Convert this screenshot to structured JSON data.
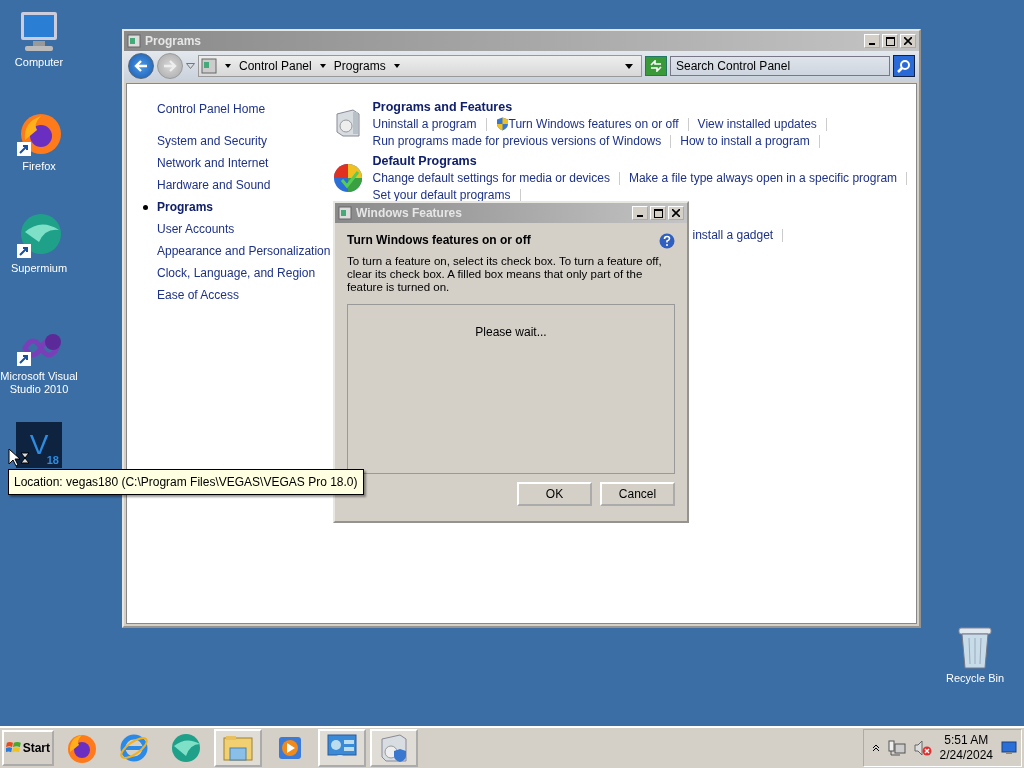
{
  "desktop_icons": [
    {
      "kind": "computer",
      "label": "Computer"
    },
    {
      "kind": "firefox",
      "label": "Firefox"
    },
    {
      "kind": "supermium",
      "label": "Supermium"
    },
    {
      "kind": "visualstudio",
      "label": "Microsoft Visual Studio 2010"
    },
    {
      "kind": "vegas",
      "logo": "V",
      "version": "18"
    },
    {
      "kind": "recyclebin",
      "label": "Recycle Bin"
    }
  ],
  "window": {
    "title": "Programs",
    "address": {
      "crumbs": [
        "Control Panel",
        "Programs"
      ]
    },
    "search": {
      "placeholder": "Search Control Panel"
    },
    "nav": {
      "items": [
        {
          "label": "Control Panel Home",
          "selected": false
        },
        {
          "label": "System and Security",
          "selected": false
        },
        {
          "label": "Network and Internet",
          "selected": false
        },
        {
          "label": "Hardware and Sound",
          "selected": false
        },
        {
          "label": "Programs",
          "selected": true
        },
        {
          "label": "User Accounts",
          "selected": false
        },
        {
          "label": "Appearance and Personalization",
          "selected": false
        },
        {
          "label": "Clock, Language, and Region",
          "selected": false
        },
        {
          "label": "Ease of Access",
          "selected": false
        }
      ]
    },
    "sections": [
      {
        "kind": "programs",
        "title": "Programs and Features",
        "rows": [
          {
            "links": [
              {
                "text": "Uninstall a program",
                "kind": "plain"
              },
              {
                "text": "Turn Windows features on or off",
                "kind": "shield"
              },
              {
                "text": "View installed updates",
                "kind": "plain"
              }
            ]
          },
          {
            "links": [
              {
                "text": "Run programs made for previous versions of Windows",
                "kind": "plain"
              },
              {
                "text": "How to install a program",
                "kind": "plain"
              }
            ]
          }
        ]
      },
      {
        "kind": "defaults",
        "title": "Default Programs",
        "rows": [
          {
            "links": [
              {
                "text": "Change default settings for media or devices",
                "kind": "plain"
              },
              {
                "text": "Make a file type always open in a specific program",
                "kind": "plain"
              }
            ]
          },
          {
            "links": [
              {
                "text": "Set your default programs",
                "kind": "plain"
              }
            ]
          }
        ]
      },
      {
        "kind": "covered",
        "rows": [
          {
            "links": [
              {
                "text": "install a gadget",
                "kind": "plain"
              }
            ]
          }
        ]
      }
    ]
  },
  "dialog": {
    "title": "Windows Features",
    "heading": "Turn Windows features on or off",
    "description": "To turn a feature on, select its check box. To turn a feature off, clear its check box. A filled box means that only part of the feature is turned on.",
    "list_message": "Please wait...",
    "buttons": [
      "OK",
      "Cancel"
    ]
  },
  "tooltip": "Location: vegas180 (C:\\Program Files\\VEGAS\\VEGAS Pro 18.0)",
  "taskbar": {
    "start": "Start",
    "items": [
      {
        "kind": "firefox",
        "selected": false
      },
      {
        "kind": "ie",
        "selected": false
      },
      {
        "kind": "supermium",
        "selected": false
      },
      {
        "kind": "explorer",
        "selected": true
      },
      {
        "kind": "mediaplayer",
        "selected": false
      },
      {
        "kind": "controlpanel",
        "selected": true
      },
      {
        "kind": "programs",
        "selected": true
      }
    ],
    "clock": {
      "time": "5:51 AM",
      "date": "2/24/2024"
    }
  }
}
